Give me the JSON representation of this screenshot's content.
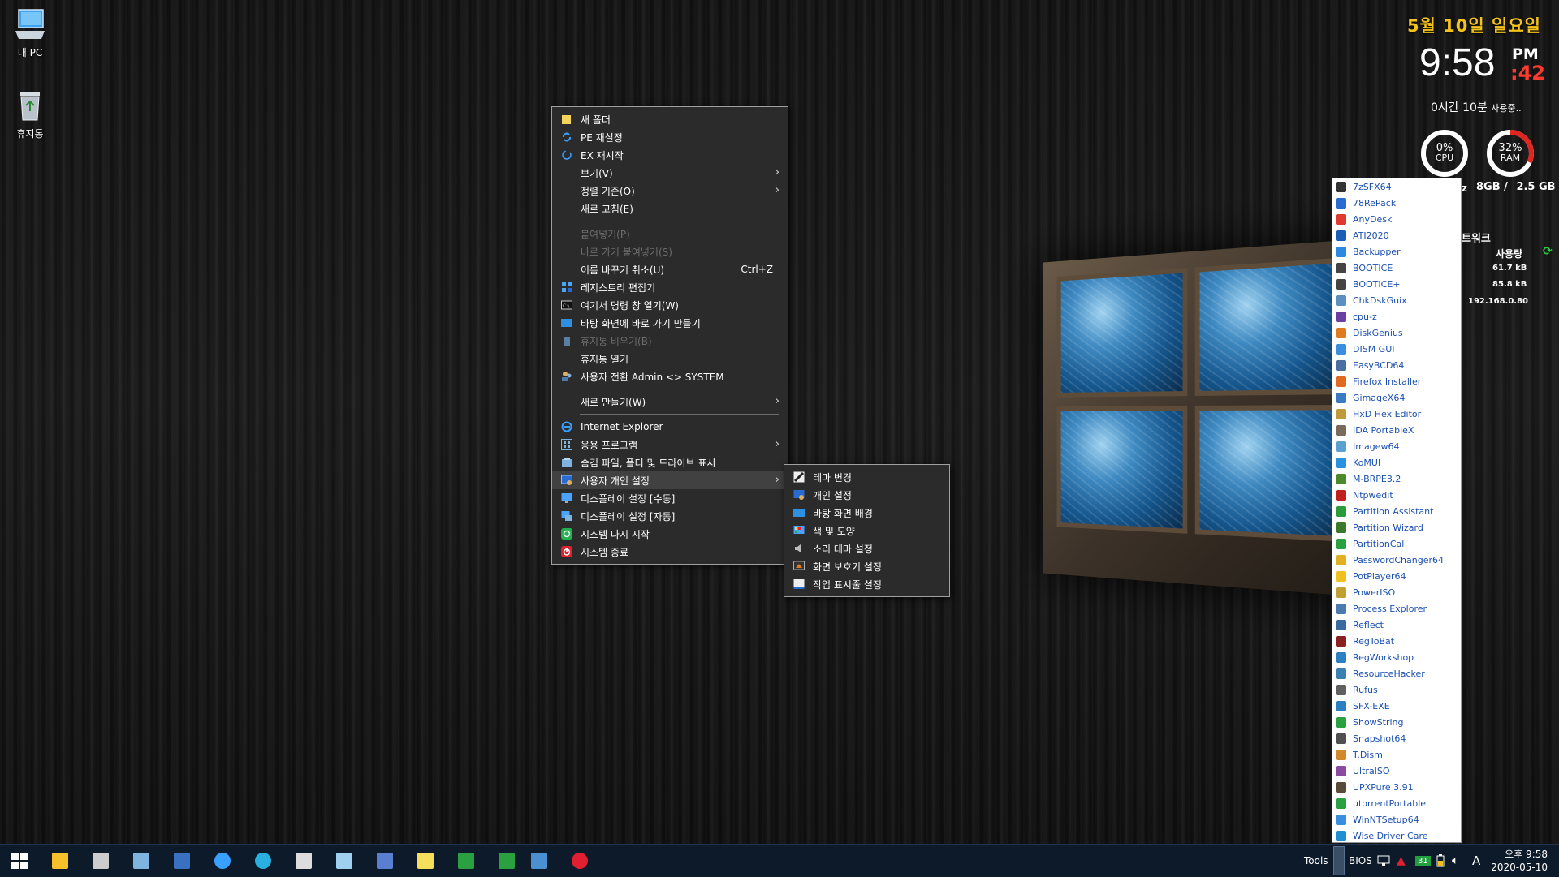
{
  "desktop": {
    "icons": [
      {
        "label": "내 PC",
        "icon": "computer-icon"
      },
      {
        "label": "휴지통",
        "icon": "recycle-bin-icon"
      }
    ]
  },
  "context_menu": {
    "items": [
      {
        "label": "새 폴더",
        "icon": "folder-icon",
        "color": "#f6d35b"
      },
      {
        "label": "PE 재설정",
        "icon": "refresh-icon",
        "color": "#3ba0ff"
      },
      {
        "label": "EX 재시작",
        "icon": "restart-icon",
        "color": "#3ba0ff"
      },
      {
        "label": "보기(V)",
        "submenu": true
      },
      {
        "label": "정렬 기준(O)",
        "submenu": true
      },
      {
        "label": "새로 고침(E)"
      },
      {
        "separator": true
      },
      {
        "label": "붙여넣기(P)",
        "disabled": true
      },
      {
        "label": "바로 가기 붙여넣기(S)",
        "disabled": true
      },
      {
        "label": "이름 바꾸기 취소(U)",
        "shortcut": "Ctrl+Z"
      },
      {
        "label": "레지스트리 편집기",
        "icon": "registry-icon",
        "color": "#4aa3ff"
      },
      {
        "label": "여기서 명령 창 열기(W)",
        "icon": "cmd-icon",
        "color": "#cccccc"
      },
      {
        "label": "바탕 화면에 바로 가기 만들기",
        "icon": "desktop-shortcut-icon",
        "color": "#2f8fe0"
      },
      {
        "label": "휴지통 비우기(B)",
        "icon": "recycle-bin-icon",
        "color": "#5a7fa0",
        "disabled": true
      },
      {
        "label": "휴지통 열기"
      },
      {
        "label": "사용자 전환 Admin <> SYSTEM",
        "icon": "users-icon",
        "color": "#7fb3e0"
      },
      {
        "separator": true
      },
      {
        "label": "새로 만들기(W)",
        "submenu": true
      },
      {
        "separator": true
      },
      {
        "label": "Internet Explorer",
        "icon": "ie-icon",
        "color": "#3aa0ff"
      },
      {
        "label": "응용 프로그램",
        "icon": "apps-icon",
        "color": "#7fb3e0",
        "submenu": true
      },
      {
        "label": "숨김 파일, 폴더 및 드라이브 표시",
        "icon": "hidden-files-icon",
        "color": "#7fb3e0"
      },
      {
        "label": "사용자 개인 설정",
        "icon": "personalize-icon",
        "color": "#7fb3e0",
        "submenu": true,
        "highlighted": true
      },
      {
        "label": "디스플레이 설정 [수동]",
        "icon": "display-icon",
        "color": "#4aa3ff"
      },
      {
        "label": "디스플레이 설정 [자동]",
        "icon": "display-auto-icon",
        "color": "#4aa3ff"
      },
      {
        "label": "시스템 다시 시작",
        "icon": "restart-green-icon",
        "color": "#22b14c"
      },
      {
        "label": "시스템 종료",
        "icon": "power-icon",
        "color": "#e02030"
      }
    ]
  },
  "submenu": {
    "items": [
      {
        "label": "테마 변경",
        "icon": "theme-icon"
      },
      {
        "label": "개인 설정",
        "icon": "personal-icon"
      },
      {
        "label": "바탕 화면 배경",
        "icon": "wallpaper-icon"
      },
      {
        "label": "색 및 모양",
        "icon": "color-icon"
      },
      {
        "label": "소리 테마 설정",
        "icon": "sound-icon"
      },
      {
        "label": "화면 보호기 설정",
        "icon": "screensaver-icon"
      },
      {
        "label": "작업 표시줄 설정",
        "icon": "taskbar-settings-icon"
      }
    ]
  },
  "gadget": {
    "date": "5월 10일 일요일",
    "time": "9:58",
    "ampm": "PM",
    "seconds": ":42",
    "uptime": "0시간 10분",
    "uptime_suffix": "사용중..",
    "cpu_percent": 0,
    "cpu_value": "0%",
    "cpu_label": "CPU",
    "ram_percent": 32,
    "ram_value": "32%",
    "ram_label": "RAM",
    "cpu_frag": "z",
    "ram_total": "8GB /",
    "ram_used": "2.5 GB",
    "network_title": "트워크",
    "network_usage_label": "사용량",
    "net_up": "61.7 kB",
    "net_down": "85.8 kB",
    "ip": "192.168.0.80",
    "accent_red": "#e0261e",
    "accent_yellow": "#f4c21b"
  },
  "tools_list": [
    {
      "label": "7zSFX64",
      "color": "#333333"
    },
    {
      "label": "78RePack",
      "color": "#2a6bd1"
    },
    {
      "label": "AnyDesk",
      "color": "#e03a2f"
    },
    {
      "label": "ATI2020",
      "color": "#1b5fb5"
    },
    {
      "label": "Backupper",
      "color": "#2b8ae0"
    },
    {
      "label": "BOOTICE",
      "color": "#444444"
    },
    {
      "label": "BOOTICE+",
      "color": "#444444"
    },
    {
      "label": "ChkDskGuix",
      "color": "#5a8fc0"
    },
    {
      "label": "cpu-z",
      "color": "#6a3fa0"
    },
    {
      "label": "DiskGenius",
      "color": "#e07a1f"
    },
    {
      "label": "DISM GUI",
      "color": "#3a8ee0"
    },
    {
      "label": "EasyBCD64",
      "color": "#4a6fa0"
    },
    {
      "label": "Firefox Installer",
      "color": "#e06a1f"
    },
    {
      "label": "GimageX64",
      "color": "#3a7ac0"
    },
    {
      "label": "HxD Hex Editor",
      "color": "#c09a3a"
    },
    {
      "label": "IDA PortableX",
      "color": "#7a6a5a"
    },
    {
      "label": "Imagew64",
      "color": "#5aa0d0"
    },
    {
      "label": "KoMUI",
      "color": "#2a90e0"
    },
    {
      "label": "M-BRPE3.2",
      "color": "#4a8a2a"
    },
    {
      "label": "Ntpwedit",
      "color": "#c02020"
    },
    {
      "label": "Partition Assistant",
      "color": "#2a9a3a"
    },
    {
      "label": "Partition Wizard",
      "color": "#3a7a2a"
    },
    {
      "label": "PartitionCal",
      "color": "#2aa040"
    },
    {
      "label": "PasswordChanger64",
      "color": "#e0b020"
    },
    {
      "label": "PotPlayer64",
      "color": "#f0c020"
    },
    {
      "label": "PowerISO",
      "color": "#c0a030"
    },
    {
      "label": "Process Explorer",
      "color": "#4a7ab0"
    },
    {
      "label": "Reflect",
      "color": "#3a6aa0"
    },
    {
      "label": "RegToBat",
      "color": "#8a2020"
    },
    {
      "label": "RegWorkshop",
      "color": "#2a80c0"
    },
    {
      "label": "ResourceHacker",
      "color": "#3a80b0"
    },
    {
      "label": "Rufus",
      "color": "#606060"
    },
    {
      "label": "SFX-EXE",
      "color": "#2a80c0"
    },
    {
      "label": "ShowString",
      "color": "#2aa040"
    },
    {
      "label": "Snapshot64",
      "color": "#505050"
    },
    {
      "label": "T.Dism",
      "color": "#d08a2a"
    },
    {
      "label": "UltraISO",
      "color": "#8a4aa0"
    },
    {
      "label": "UPXPure 3.91",
      "color": "#5a4a3a"
    },
    {
      "label": "utorrentPortable",
      "color": "#2aa040"
    },
    {
      "label": "WinNTSetup64",
      "color": "#3a8ee0"
    },
    {
      "label": "Wise Driver Care",
      "color": "#1f8fd0"
    }
  ],
  "taskbar": {
    "pinned": [
      {
        "name": "explorer-icon",
        "color": "#f6c12b"
      },
      {
        "name": "terminal-icon",
        "color": "#cccccc"
      },
      {
        "name": "window-app-icon",
        "color": "#7fb3e0"
      },
      {
        "name": "save-disk-icon",
        "color": "#3a70c0"
      },
      {
        "name": "internet-explorer-icon",
        "color": "#3aa0ff"
      },
      {
        "name": "edge-icon",
        "color": "#2ab0e0"
      },
      {
        "name": "keyboard-icon",
        "color": "#dddddd"
      },
      {
        "name": "tablet-icon",
        "color": "#9fd0f0"
      },
      {
        "name": "network-grid-icon",
        "color": "#5a7fd0"
      },
      {
        "name": "notepad-icon",
        "color": "#f6e05b"
      },
      {
        "name": "spreadsheet-icon",
        "color": "#2aa040"
      },
      {
        "name": "monitor-green-icon",
        "color": "#2aa040"
      },
      {
        "name": "folder-blue-icon",
        "color": "#4a90d0"
      },
      {
        "name": "power-button-icon",
        "color": "#e02030"
      }
    ],
    "tools_label": "Tools",
    "bios_label": "BIOS",
    "tray_day": "31",
    "ime": "A",
    "clock_time": "오후 9:58",
    "clock_date": "2020-05-10"
  }
}
